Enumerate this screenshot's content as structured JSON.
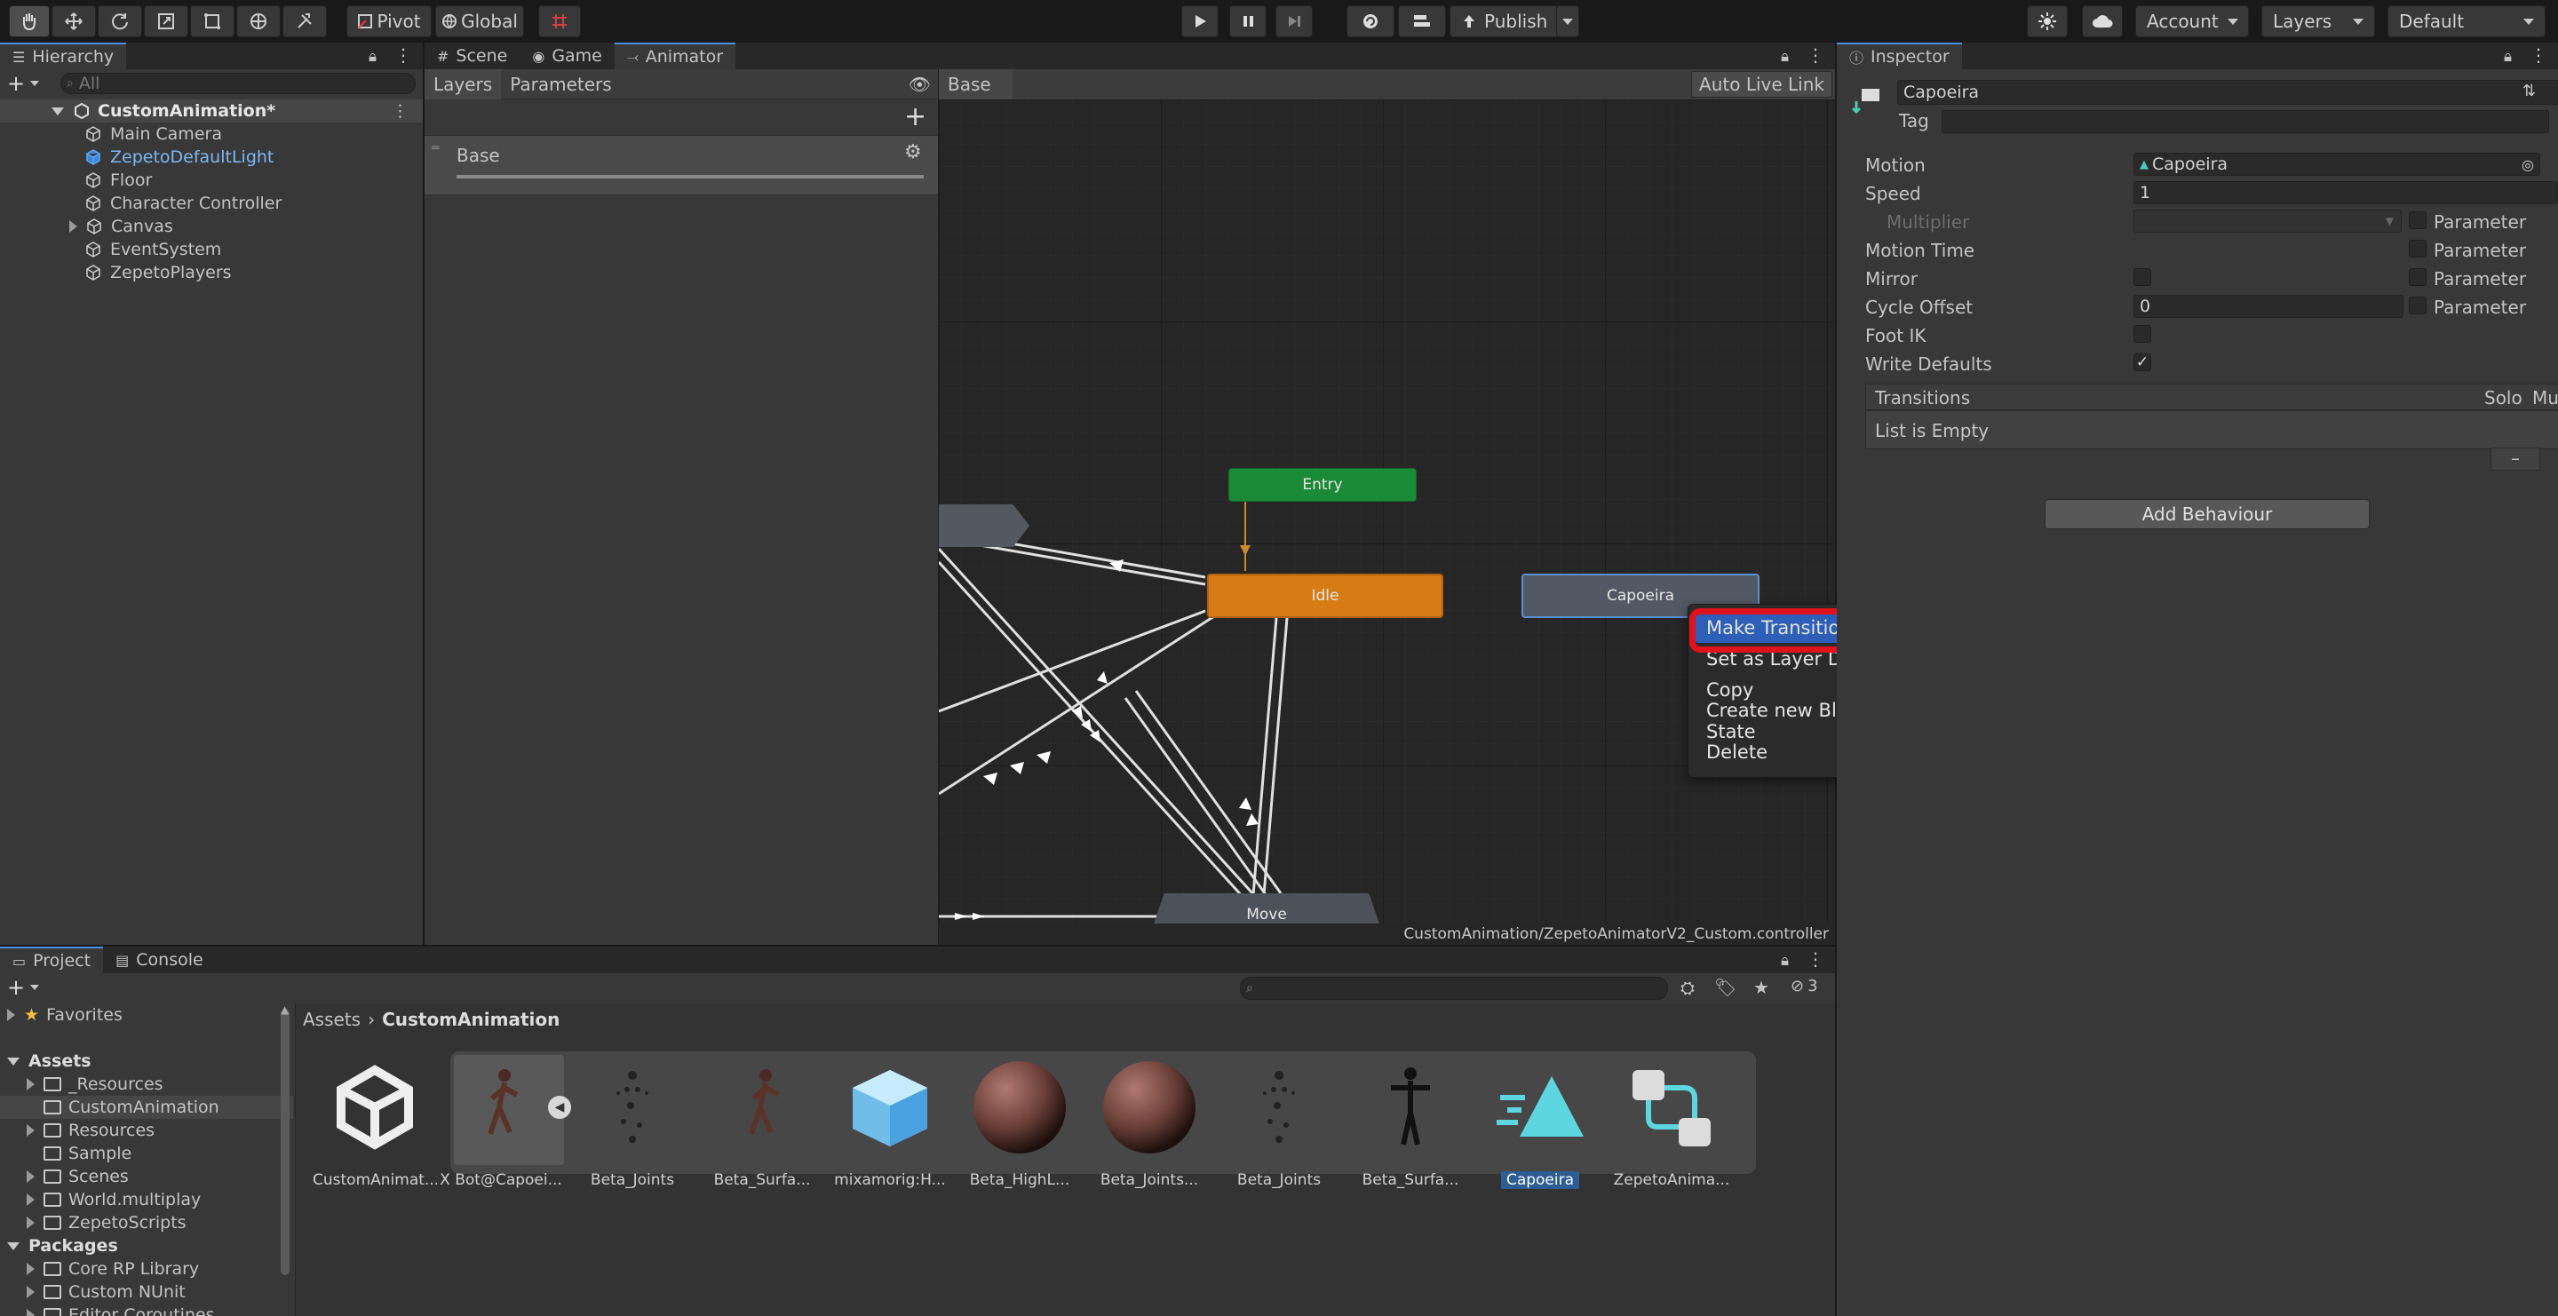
{
  "toolbar": {
    "pivot": "Pivot",
    "global": "Global",
    "publish": "Publish",
    "account": "Account",
    "layers": "Layers",
    "layout": "Default"
  },
  "hierarchy": {
    "tab": "Hierarchy",
    "search_placeholder": "All",
    "scene": "CustomAnimation*",
    "items": [
      "Main Camera",
      "ZepetoDefaultLight",
      "Floor",
      "Character Controller",
      "Canvas",
      "EventSystem",
      "ZepetoPlayers"
    ]
  },
  "center_tabs": {
    "scene": "Scene",
    "game": "Game",
    "animator": "Animator"
  },
  "animator": {
    "layers_tab": "Layers",
    "parameters_tab": "Parameters",
    "breadcrumb": "Base",
    "auto_live_link": "Auto Live Link",
    "layer_name": "Base",
    "nodes": {
      "entry": "Entry",
      "idle": "Idle",
      "capoeira": "Capoeira",
      "move": "Move"
    },
    "footer_path": "CustomAnimation/ZepetoAnimatorV2_Custom.controller"
  },
  "context_menu": {
    "items": [
      "Make Transition",
      "Set as Layer Default State",
      "Copy",
      "Create new BlendTree in State",
      "Delete"
    ],
    "highlighted": "Make Transition",
    "highlight_color": "#2d5fb8",
    "annotation_color": "#e0121b"
  },
  "inspector": {
    "tab": "Inspector",
    "name": "Capoeira",
    "tag_label": "Tag",
    "motion_label": "Motion",
    "motion_value": "Capoeira",
    "speed_label": "Speed",
    "speed_value": "1",
    "multiplier_label": "Multiplier",
    "motion_time_label": "Motion Time",
    "mirror_label": "Mirror",
    "cycle_offset_label": "Cycle Offset",
    "cycle_offset_value": "0",
    "foot_ik_label": "Foot IK",
    "write_defaults_label": "Write Defaults",
    "parameter_label": "Parameter",
    "transitions_label": "Transitions",
    "solo_label": "Solo",
    "mute_label": "Mute",
    "list_empty": "List is Empty",
    "minus": "–",
    "add_behaviour": "Add Behaviour"
  },
  "project": {
    "project_tab": "Project",
    "console_tab": "Console",
    "hidden_count": "3",
    "breadcrumb_root": "Assets",
    "breadcrumb_current": "CustomAnimation",
    "tree": {
      "favorites": "Favorites",
      "assets": "Assets",
      "asset_folders": [
        "_Resources",
        "CustomAnimation",
        "Resources",
        "Sample",
        "Scenes",
        "World.multiplay",
        "ZepetoScripts"
      ],
      "packages": "Packages",
      "package_folders": [
        "Core RP Library",
        "Custom NUnit",
        "Editor Coroutines"
      ]
    },
    "assets": [
      "CustomAnimat...",
      "X Bot@Capoei...",
      "Beta_Joints",
      "Beta_Surfa...",
      "mixamorig:H...",
      "Beta_HighL...",
      "Beta_Joints...",
      "Beta_Joints",
      "Beta_Surfa...",
      "Capoeira",
      "ZepetoAnima..."
    ]
  }
}
